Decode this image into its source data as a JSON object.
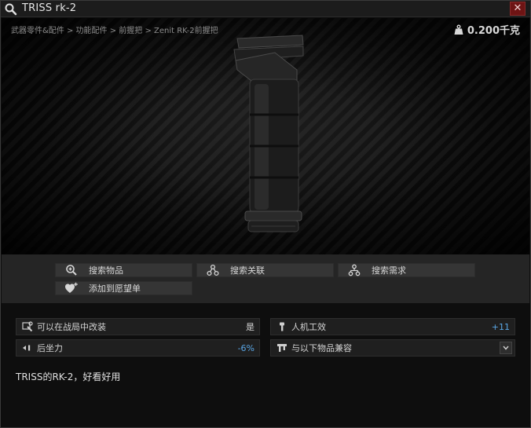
{
  "window": {
    "title": "TRISS rk-2",
    "close_label": "✕"
  },
  "header": {
    "breadcrumb": "武器零件&配件 > 功能配件 > 前握把 > Zenit RK-2前握把",
    "weight": "0.200千克"
  },
  "actions": {
    "search_item": "搜索物品",
    "search_related": "搜索关联",
    "search_requirements": "搜索需求",
    "add_wishlist": "添加到愿望单"
  },
  "stats": {
    "raid_modding": {
      "label": "可以在战局中改装",
      "value": "是"
    },
    "ergonomics": {
      "label": "人机工效",
      "value": "+11"
    },
    "recoil": {
      "label": "后坐力",
      "value": "-6%"
    },
    "compatible": {
      "label": "与以下物品兼容"
    }
  },
  "description": "TRISS的RK-2，好看好用",
  "colors": {
    "accent_blue": "#5aa7e6",
    "close_red": "#6e1414",
    "panel": "#252525"
  }
}
